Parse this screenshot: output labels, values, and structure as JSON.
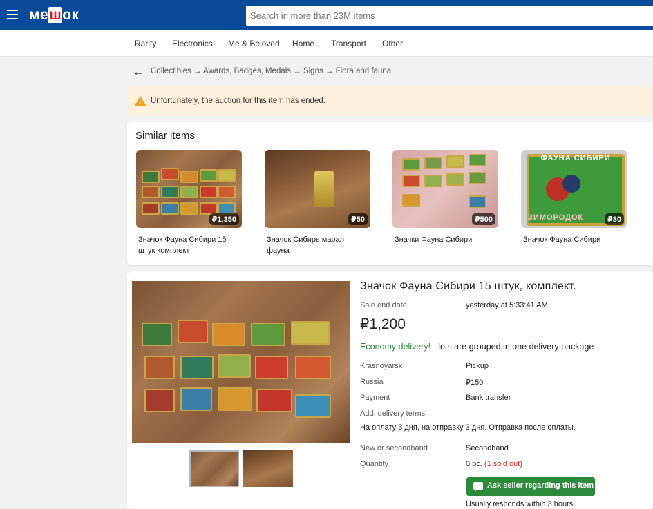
{
  "header": {
    "logo_prefix": "ме",
    "logo_mid": "ш",
    "logo_suffix": "ок",
    "search_placeholder": "Search in more than 23M items"
  },
  "nav": [
    "Rarity",
    "Electronics",
    "Me & Beloved",
    "Home",
    "Transport",
    "Other"
  ],
  "breadcrumb": "Collectibles → Awards, Badges, Medals → Signs → Flora and fauna",
  "warning": "Unfortunately, the auction for this item has ended.",
  "similar": {
    "heading": "Similar items",
    "items": [
      {
        "title": "Значок Фауна Сибири 15 штук комплект",
        "price": "₽1,350"
      },
      {
        "title": "Значок Сибирь марал фауна",
        "price": "₽50"
      },
      {
        "title": "Значки Фауна Сибири",
        "price": "₽500"
      },
      {
        "title": "Значок Фауна Сибири",
        "price": "₽80"
      }
    ],
    "badge_text": {
      "top": "ФАУНА СИБИРИ",
      "bottom": "ЗИМОРОДОК"
    }
  },
  "item": {
    "title": "Значок Фауна Сибири 15 штук, комплект.",
    "sale_end_label": "Sale end date",
    "sale_end_value": "yesterday at 5:33:41 AM",
    "price": "₽1,200",
    "delivery_highlight": "Economy delivery!",
    "delivery_rest": " - lots are grouped in one delivery package",
    "city": "Krasnoyarsk",
    "pickup": "Pickup",
    "country": "Russia",
    "shipping_price": "₽150",
    "payment_label": "Payment",
    "payment_value": "Bank transfer",
    "terms_label": "Add. delivery terms",
    "terms_value": "На оплату 3 дня, на отправку 3 дня. Отправка после оплаты.",
    "condition_label": "New or secondhand",
    "condition_value": "Secondhand",
    "quantity_label": "Quantity",
    "quantity_value": "0 pc.",
    "sold_out": "(1 sold out)",
    "ask_button": "Ask seller regarding this item",
    "responds": "Usually responds within 3 hours"
  },
  "colors": {
    "header": "#0a4a9a",
    "accent_green": "#2c8a3b",
    "warning_bg": "#fdf0dc",
    "sold_red": "#d23232"
  }
}
